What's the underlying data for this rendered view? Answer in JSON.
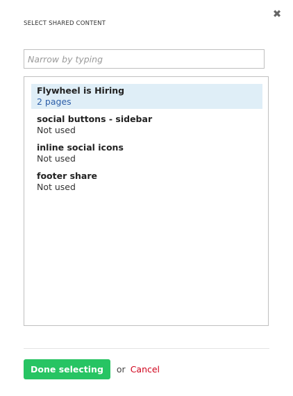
{
  "dialog": {
    "title": "SELECT SHARED CONTENT",
    "close_icon": "close-icon"
  },
  "search": {
    "placeholder": "Narrow by typing",
    "value": ""
  },
  "items": [
    {
      "name": "Flywheel is Hiring",
      "status": "2 pages",
      "selected": true
    },
    {
      "name": "social buttons - sidebar",
      "status": "Not used",
      "selected": false
    },
    {
      "name": "inline social icons",
      "status": "Not used",
      "selected": false
    },
    {
      "name": "footer share",
      "status": "Not used",
      "selected": false
    }
  ],
  "footer": {
    "done_label": "Done selecting",
    "or_label": "or",
    "cancel_label": "Cancel"
  },
  "colors": {
    "accent_green": "#27c463",
    "cancel_red": "#d0021b",
    "selected_bg": "#dfeef7",
    "link_blue": "#2c5ea8"
  }
}
